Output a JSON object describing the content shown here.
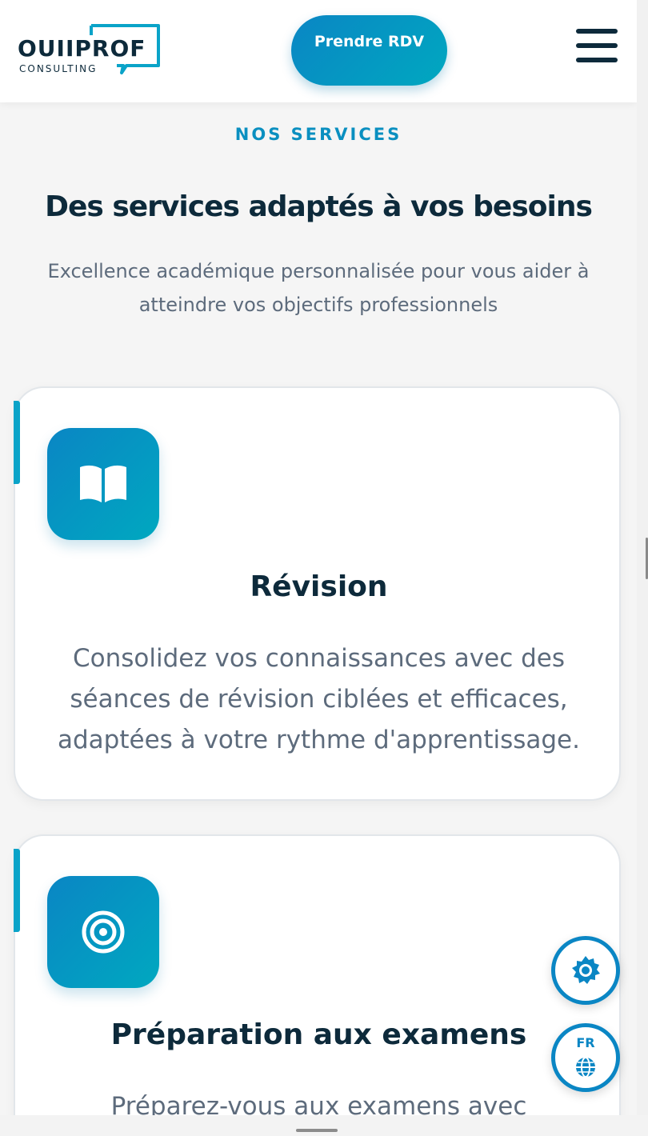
{
  "header": {
    "logo_word": "OUIIPROF",
    "logo_sub": "CONSULTING",
    "cta_label": "Prendre RDV",
    "menu_icon": "hamburger-menu-icon"
  },
  "section": {
    "eyebrow": "NOS SERVICES",
    "title": "Des services adaptés à vos besoins",
    "subtitle": "Excellence académique personnalisée pour vous aider à atteindre vos objectifs professionnels"
  },
  "cards": [
    {
      "icon": "book-icon",
      "title": "Révision",
      "text": "Consolidez vos connaissances avec des séances de révision ciblées et efficaces, adaptées à votre rythme d'apprentissage."
    },
    {
      "icon": "target-icon",
      "title": "Préparation aux examens",
      "text": "Préparez-vous aux examens avec"
    }
  ],
  "floating": {
    "settings_icon": "gear-icon",
    "lang_label": "FR",
    "lang_icon": "globe-icon"
  },
  "colors": {
    "accent": "#0a86c4",
    "accent_end": "#00a8c0",
    "heading": "#0d2a3b",
    "muted": "#5d6b7c"
  }
}
